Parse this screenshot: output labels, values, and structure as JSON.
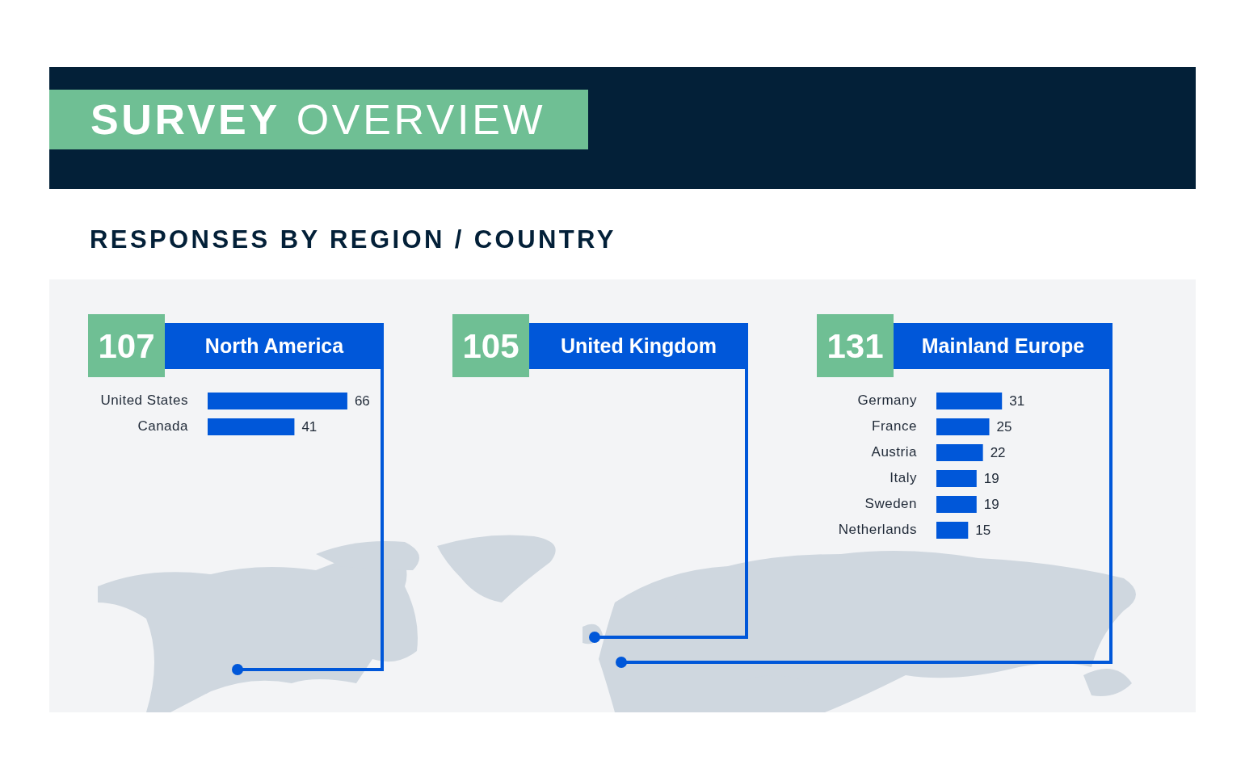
{
  "header": {
    "title_bold": "SURVEY",
    "title_light": "OVERVIEW"
  },
  "section_title": "RESPONSES BY REGION / COUNTRY",
  "regions": [
    {
      "count": "107",
      "name": "North America",
      "chart_data": {
        "type": "bar",
        "orientation": "horizontal",
        "categories": [
          "United States",
          "Canada"
        ],
        "values": [
          66,
          41
        ],
        "data_labels": true
      }
    },
    {
      "count": "105",
      "name": "United Kingdom"
    },
    {
      "count": "131",
      "name": "Mainland Europe",
      "chart_data": {
        "type": "bar",
        "orientation": "horizontal",
        "categories": [
          "Germany",
          "France",
          "Austria",
          "Italy",
          "Sweden",
          "Netherlands"
        ],
        "values": [
          31,
          25,
          22,
          19,
          19,
          15
        ],
        "data_labels": true
      }
    }
  ]
}
